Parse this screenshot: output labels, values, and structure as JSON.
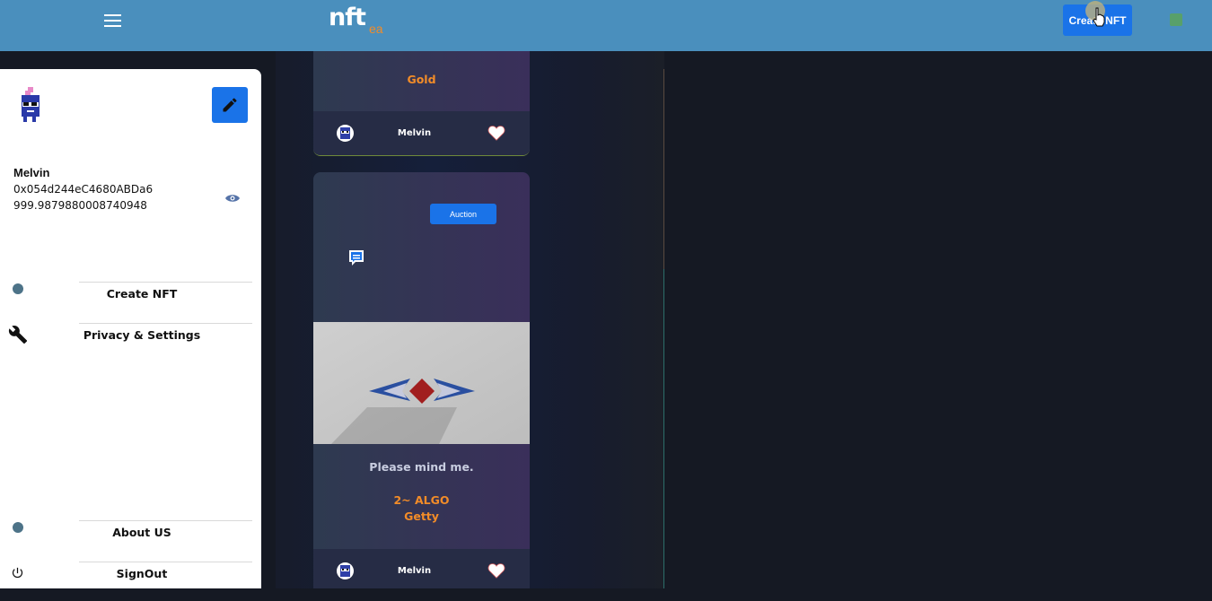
{
  "header": {
    "logo_main": "nft",
    "logo_sub": "ea",
    "create_button": "Create NFT"
  },
  "drawer": {
    "username": "Melvin",
    "address": "0x054d244eC4680ABDa6",
    "balance": "999.9879880008740948",
    "menu": [
      {
        "label": "Create NFT",
        "icon": "circle-icon"
      },
      {
        "label": "Privacy & Settings",
        "icon": "wrench-icon"
      },
      {
        "label": "About US",
        "icon": "circle-icon"
      },
      {
        "label": "SignOut",
        "icon": "power-icon"
      }
    ]
  },
  "cards": [
    {
      "price_label": "Gold",
      "owner": "Melvin"
    },
    {
      "auction_label": "Auction",
      "description": "Please mind me.",
      "price": "2~ ALGO",
      "tier": "Getty",
      "owner": "Melvin"
    }
  ],
  "colors": {
    "header_bg": "#4a8fbd",
    "accent_blue": "#1a73e8",
    "accent_orange": "#f28c28",
    "page_bg": "#151923"
  }
}
